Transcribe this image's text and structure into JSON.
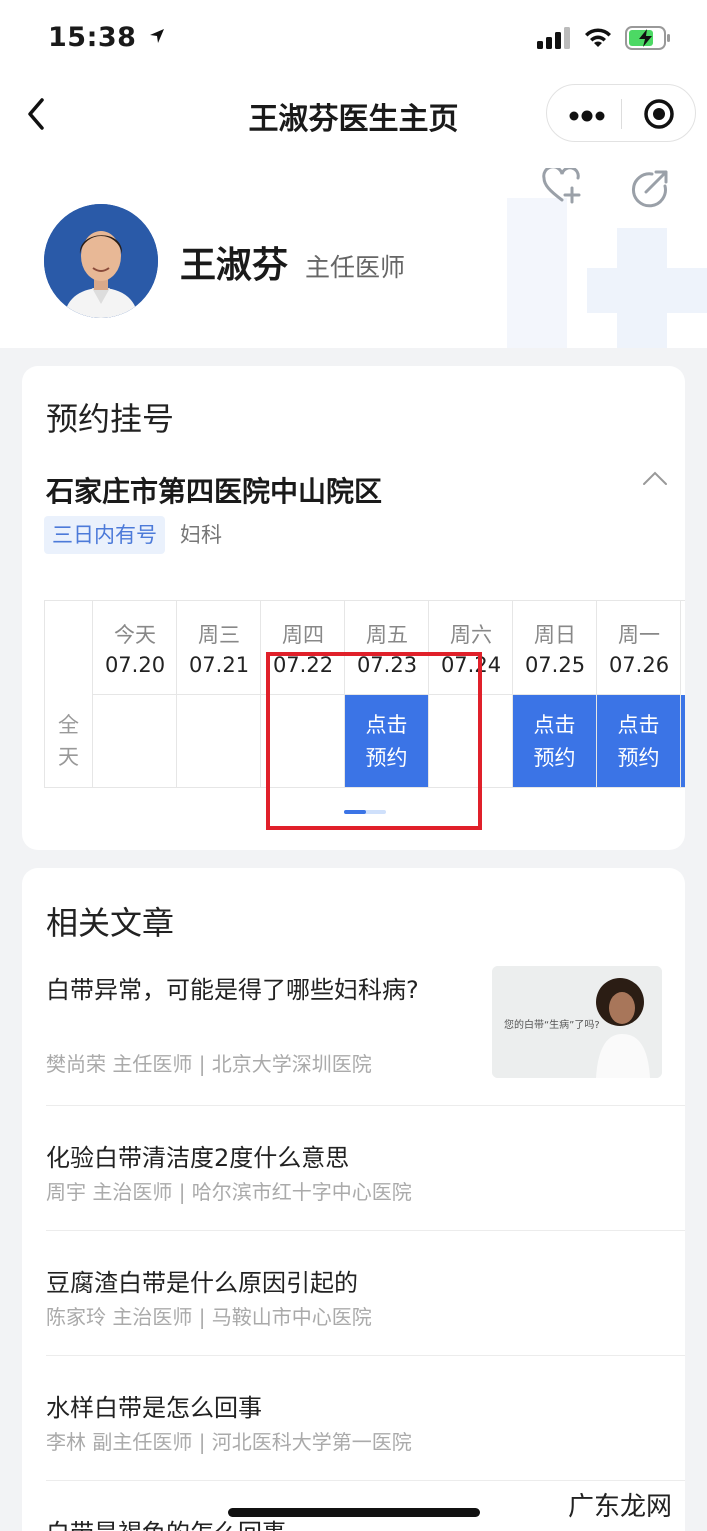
{
  "status_bar": {
    "time": "15:38"
  },
  "nav": {
    "title": "王淑芬医生主页"
  },
  "doctor": {
    "name": "王淑芬",
    "title": "主任医师"
  },
  "appointment": {
    "section_title": "预约挂号",
    "hospital": "石家庄市第四医院中山院区",
    "availability_tag": "三日内有号",
    "department": "妇科",
    "row_label": "全天",
    "days": [
      {
        "weekday": "今天",
        "date": "07.20",
        "status": ""
      },
      {
        "weekday": "周三",
        "date": "07.21",
        "status": ""
      },
      {
        "weekday": "周四",
        "date": "07.22",
        "status": ""
      },
      {
        "weekday": "周五",
        "date": "07.23",
        "status": "点击\n预约"
      },
      {
        "weekday": "周六",
        "date": "07.24",
        "status": ""
      },
      {
        "weekday": "周日",
        "date": "07.25",
        "status": "点击\n预约"
      },
      {
        "weekday": "周一",
        "date": "07.26",
        "status": "点击\n预约"
      }
    ],
    "book_label_line1": "点击",
    "book_label_line2": "预约"
  },
  "articles": {
    "section_title": "相关文章",
    "items": [
      {
        "title": "白带异常，可能是得了哪些妇科病?",
        "meta": "樊尚荣 主任医师 | 北京大学深圳医院",
        "thumbnail_caption": "您的白带“生病”了吗?"
      },
      {
        "title": "化验白带清洁度2度什么意思",
        "meta": "周宇 主治医师 | 哈尔滨市红十字中心医院"
      },
      {
        "title": "豆腐渣白带是什么原因引起的",
        "meta": "陈家玲 主治医师 | 马鞍山市中心医院"
      },
      {
        "title": "水样白带是怎么回事",
        "meta": "李林 副主任医师 | 河北医科大学第一医院"
      },
      {
        "title": "白带是褐色的怎么回事",
        "meta": ""
      }
    ]
  },
  "watermark": "广东龙网",
  "colors": {
    "accent": "#3b74e6",
    "highlight_box": "#e0202a"
  }
}
